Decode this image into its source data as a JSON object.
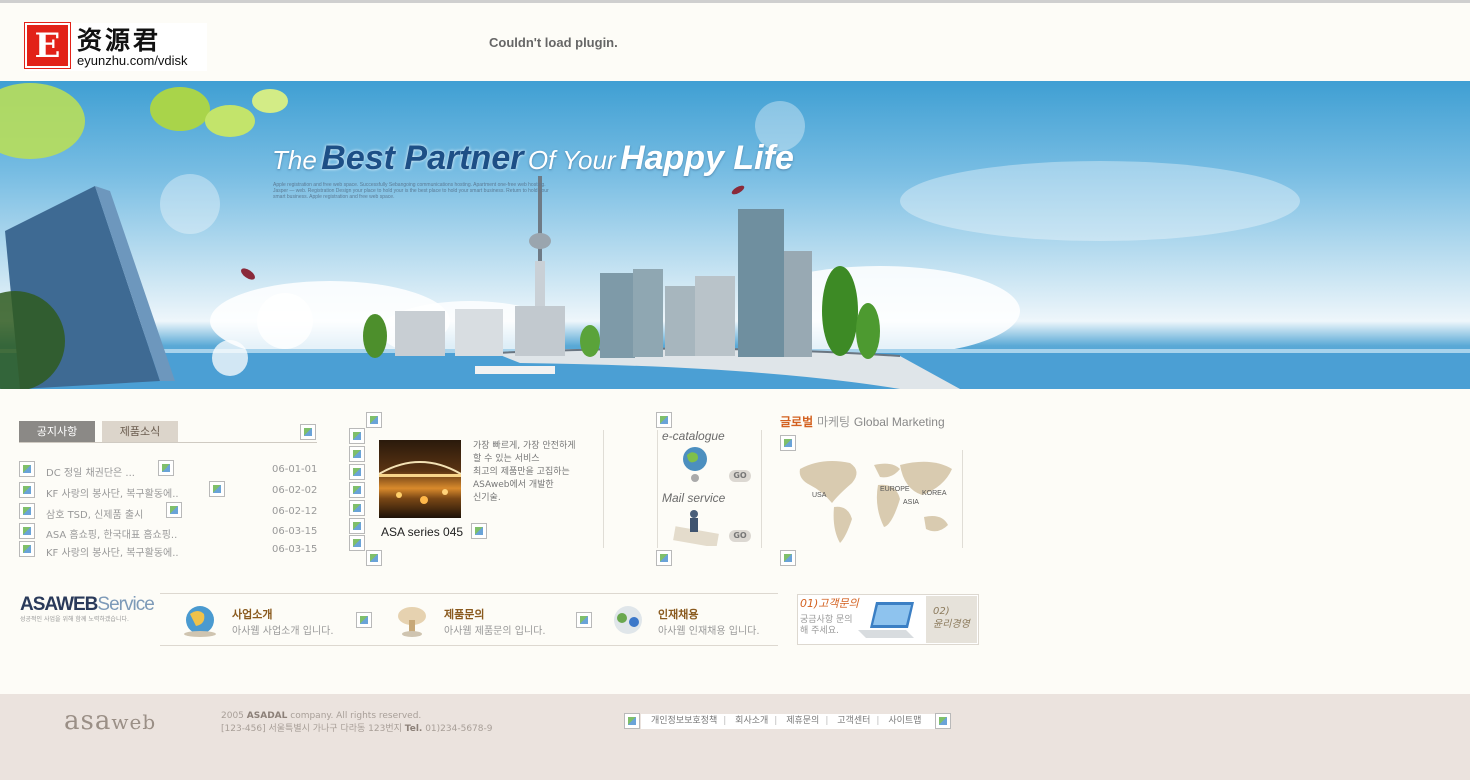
{
  "header": {
    "logo_letter": "E",
    "logo_chinese": "资源君",
    "logo_url": "eyunzhu.com/vdisk",
    "plugin_message": "Couldn't load plugin."
  },
  "banner": {
    "tagline": {
      "the": "The",
      "best_partner": "Best Partner",
      "of_your": "Of Your",
      "happy_life": "Happy Life"
    },
    "subtext": "Apple registration and free web space. Successfully Sebangoing communications hosting. Apartment one-free web hosting. Jasper — web. Registration Design your place to hold your is the best place to hold your smart business. Return to hold your smart business. Apple registration and free web space."
  },
  "notice": {
    "tabs": [
      "공지사항",
      "제품소식"
    ],
    "items": [
      {
        "title": "DC 정일 채권단은 ...",
        "date": "06-01-01"
      },
      {
        "title": "KF 사랑의 봉사단, 복구활동에..",
        "date": "06-02-02"
      },
      {
        "title": "삼호 TSD, 신제품 출시",
        "date": "06-02-12"
      },
      {
        "title": "ASA 홈쇼핑, 한국대표 홈쇼핑..",
        "date": "06-03-15"
      },
      {
        "title": "KF 사랑의 봉사단, 복구활동에..",
        "date": "06-03-15"
      }
    ]
  },
  "product": {
    "lines": [
      "가장 빠르게, 가장 안전하게",
      "할 수 있는 서비스",
      "최고의 제품만을 고집하는",
      "ASAweb에서 개발한",
      "신기술."
    ],
    "name": "ASA series 045"
  },
  "catalogue": {
    "ecatalogue_label": "e-catalogue",
    "mail_label": "Mail service",
    "go_label": "GO"
  },
  "global_marketing": {
    "title_orange": "글로벌",
    "title_gray": "마케팅",
    "title_en": "Global Marketing",
    "regions": [
      "USA",
      "EUROPE",
      "ASIA",
      "KOREA"
    ]
  },
  "services": {
    "logo_bold": "ASAWEB",
    "logo_light": "Service",
    "logo_sub": "성공적인 사업을 위해 함께 노력하겠습니다.",
    "items": [
      {
        "title": "사업소개",
        "desc": "아사웹 사업소개 입니다."
      },
      {
        "title": "제품문의",
        "desc": "아사웹 제품문의 입니다."
      },
      {
        "title": "인재채용",
        "desc": "아사웹 인재채용 입니다."
      }
    ],
    "customer_title": "01)고객문의",
    "customer_desc": "궁금사항 문의해 주세요.",
    "ethics_num": "02)",
    "ethics_label": "윤리경영"
  },
  "footer": {
    "logo_main": "asa",
    "logo_web": "web",
    "copyright_year": "2005",
    "copyright_company": "ASADAL",
    "copyright_rest": "company. All rights reserved.",
    "address": "[123-456] 서울특별시 가나구 다라동 123번지",
    "tel_label": "Tel.",
    "tel": "01)234-5678-9",
    "links": [
      "개인정보보호정책",
      "회사소개",
      "제휴문의",
      "고객센터",
      "사이트맵"
    ]
  },
  "colors": {
    "logo_red": "#e22218",
    "accent_orange": "#d3601f",
    "tab_active": "#8b8986",
    "tab_inactive": "#dcd5cb",
    "footer_bg": "#ebe3de",
    "page_bg": "#fdfcf7"
  }
}
